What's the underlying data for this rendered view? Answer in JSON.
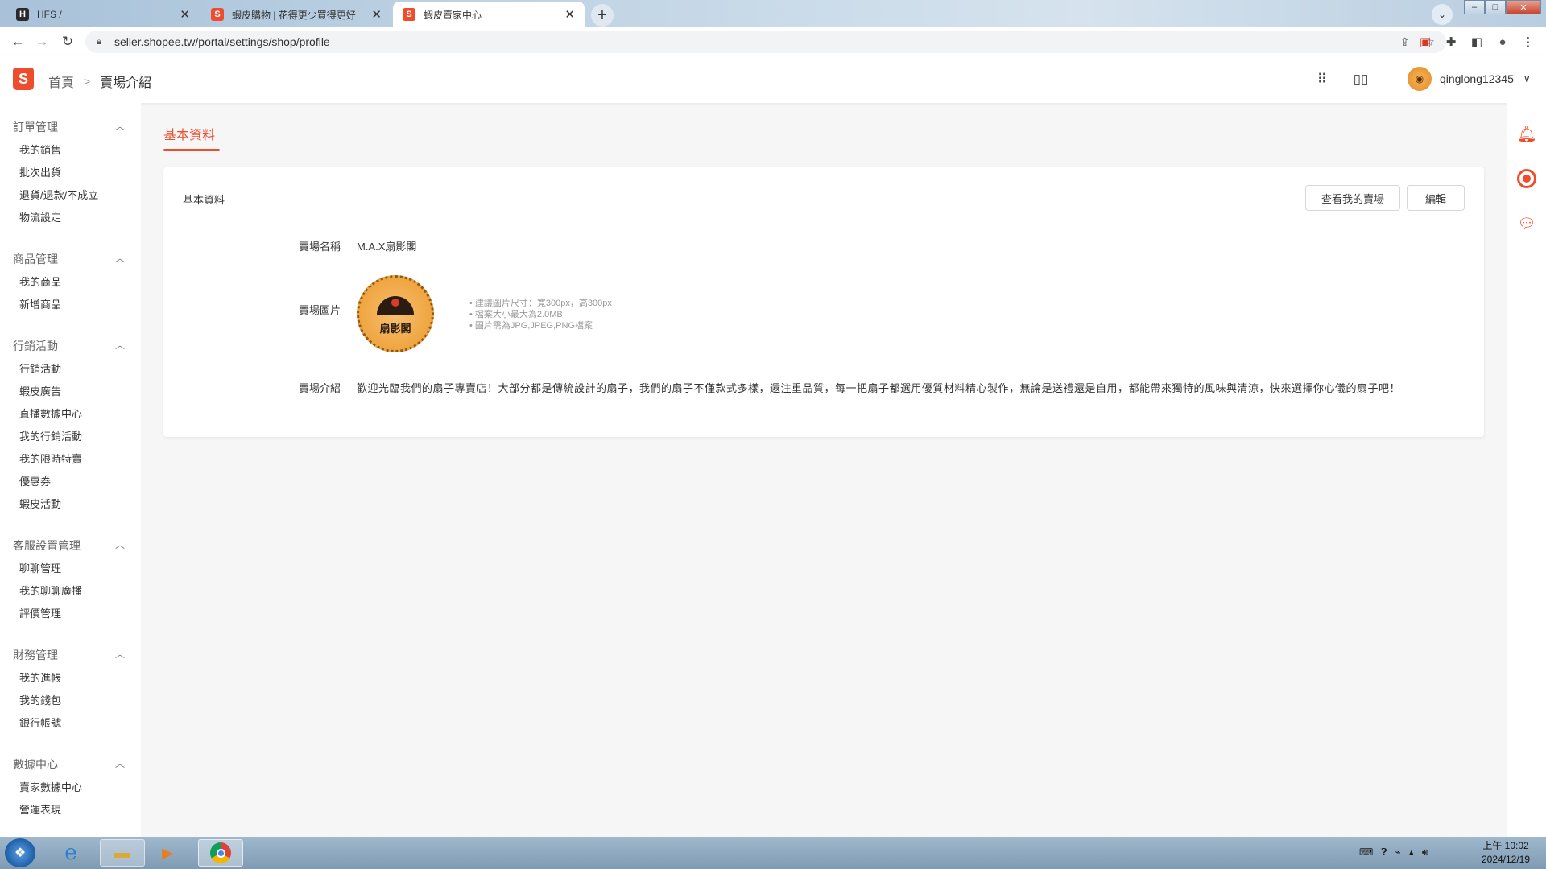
{
  "browser": {
    "tabs": [
      {
        "title": "HFS /",
        "icon": "hfs-icon",
        "active": false
      },
      {
        "title": "蝦皮購物 | 花得更少買得更好",
        "icon": "shopee-icon",
        "active": false
      },
      {
        "title": "蝦皮賣家中心",
        "icon": "shopee-icon",
        "active": true
      }
    ],
    "url": "seller.shopee.tw/portal/settings/shop/profile"
  },
  "header": {
    "breadcrumb_home": "首頁",
    "breadcrumb_current": "賣場介紹",
    "username": "qinglong12345"
  },
  "sidebar": {
    "groups": [
      {
        "title": "訂單管理",
        "items": [
          "我的銷售",
          "批次出貨",
          "退貨/退款/不成立",
          "物流設定"
        ]
      },
      {
        "title": "商品管理",
        "items": [
          "我的商品",
          "新增商品"
        ]
      },
      {
        "title": "行銷活動",
        "items": [
          "行銷活動",
          "蝦皮廣告",
          "直播數據中心",
          "我的行銷活動",
          "我的限時特賣",
          "優惠券",
          "蝦皮活動"
        ]
      },
      {
        "title": "客服設置管理",
        "items": [
          "聊聊管理",
          "我的聊聊廣播",
          "評價管理"
        ]
      },
      {
        "title": "財務管理",
        "items": [
          "我的進帳",
          "我的錢包",
          "銀行帳號"
        ]
      },
      {
        "title": "數據中心",
        "items": [
          "賣家數據中心",
          "營運表現"
        ]
      }
    ]
  },
  "main": {
    "tab_label": "基本資料",
    "card_title": "基本資料",
    "view_shop_button": "查看我的賣場",
    "edit_button": "編輯",
    "shop_name_label": "賣場名稱",
    "shop_name_value": "M.A.X扇影閣",
    "shop_image_label": "賣場圖片",
    "shop_logo_text": "扇影閣",
    "image_tips": [
      "建議圖片尺寸：寬300px，高300px",
      "檔案大小最大為2.0MB",
      "圖片需為JPG,JPEG,PNG檔案"
    ],
    "shop_desc_label": "賣場介紹",
    "shop_desc_value": "歡迎光臨我們的扇子專賣店！大部分都是傳統設計的扇子，我們的扇子不僅款式多樣，還注重品質，每一把扇子都選用優質材料精心製作，無論是送禮還是自用，都能帶來獨特的風味與清涼，快來選擇你心儀的扇子吧！"
  },
  "taskbar": {
    "time": "上午 10:02",
    "date": "2024/12/19"
  },
  "colors": {
    "brand": "#ee4d2d",
    "page_bg": "#f6f6f6"
  }
}
